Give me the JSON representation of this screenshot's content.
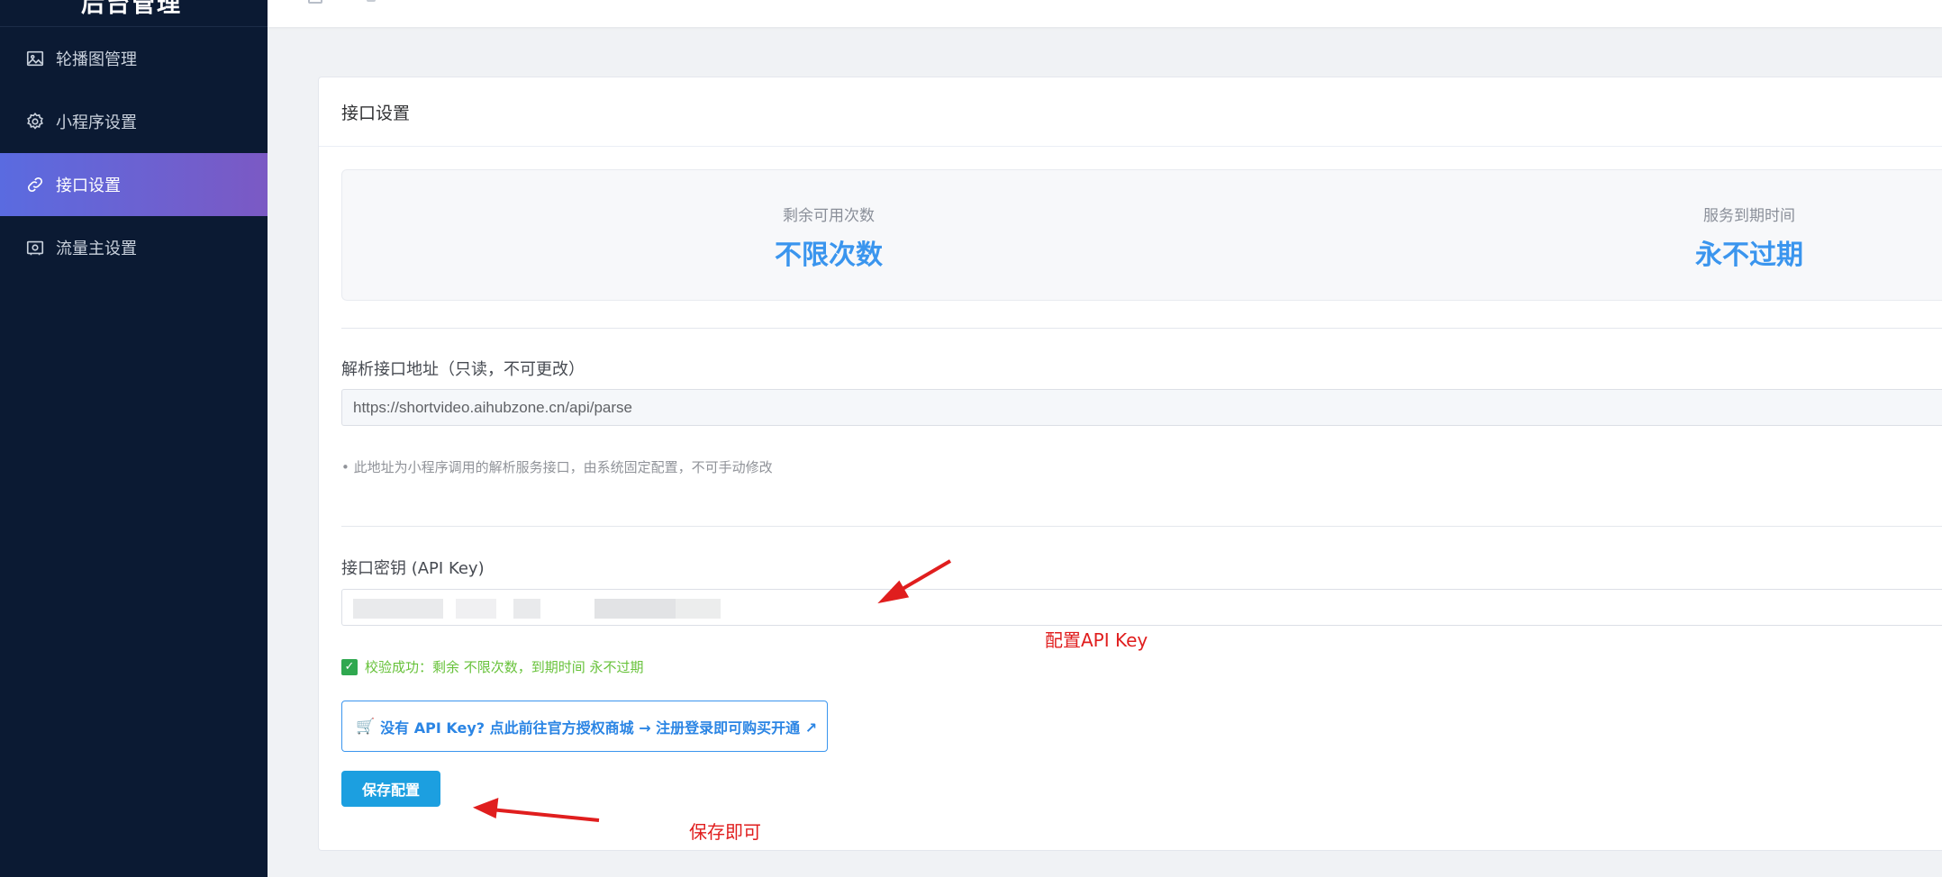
{
  "sidebar": {
    "logo": "后台管理",
    "items": [
      {
        "label": "轮播图管理",
        "icon": "image-icon",
        "active": false
      },
      {
        "label": "小程序设置",
        "icon": "gear-icon",
        "active": false
      },
      {
        "label": "接口设置",
        "icon": "link-icon",
        "active": true
      },
      {
        "label": "流量主设置",
        "icon": "ad-icon",
        "active": false
      }
    ]
  },
  "card": {
    "title": "接口设置",
    "stats": {
      "remaining_label": "剩余可用次数",
      "remaining_value": "不限次数",
      "expiry_label": "服务到期时间",
      "expiry_value": "永不过期"
    },
    "parse_url": {
      "label": "解析接口地址（只读，不可更改）",
      "value": "https://shortvideo.aihubzone.cn/api/parse",
      "hint": "• 此地址为小程序调用的解析服务接口，由系统固定配置，不可手动修改"
    },
    "api_key": {
      "label": "接口密钥 (API Key)",
      "value": ""
    },
    "success_msg": "校验成功：剩余 不限次数，到期时间 永不过期",
    "buy_link": "没有 API Key? 点此前往官方授权商城 → 注册登录即可购买开通 ↗",
    "save_label": "保存配置"
  },
  "annotations": {
    "api_key_note": "配置API Key",
    "save_note": "保存即可"
  },
  "colors": {
    "sidebar_bg": "#0b1a33",
    "active_gradient_start": "#5a6be0",
    "active_gradient_end": "#7b59c4",
    "stat_value": "#3a95ee",
    "success": "#67c23a",
    "primary_button": "#1c9fe0",
    "annotation_red": "#e01e1e"
  }
}
